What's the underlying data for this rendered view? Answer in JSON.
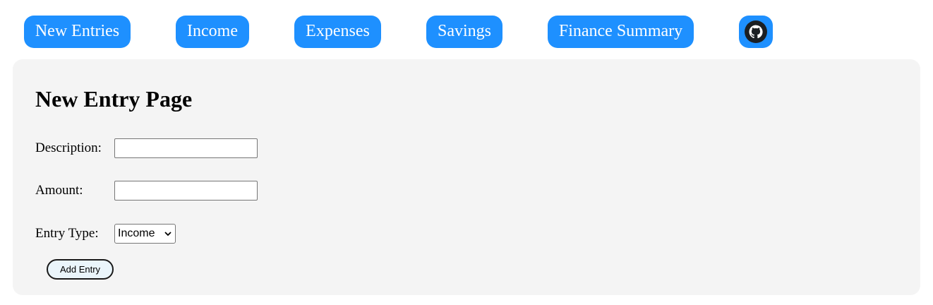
{
  "nav": {
    "items": [
      {
        "label": "New Entries"
      },
      {
        "label": "Income"
      },
      {
        "label": "Expenses"
      },
      {
        "label": "Savings"
      },
      {
        "label": "Finance Summary"
      }
    ],
    "github_icon": "github-icon",
    "accent_color": "#1e90ff"
  },
  "main": {
    "title": "New Entry Page",
    "form": {
      "description_label": "Description:",
      "description_value": "",
      "amount_label": "Amount:",
      "amount_value": "",
      "entry_type_label": "Entry Type:",
      "entry_type_selected": "Income",
      "submit_label": "Add Entry"
    }
  }
}
